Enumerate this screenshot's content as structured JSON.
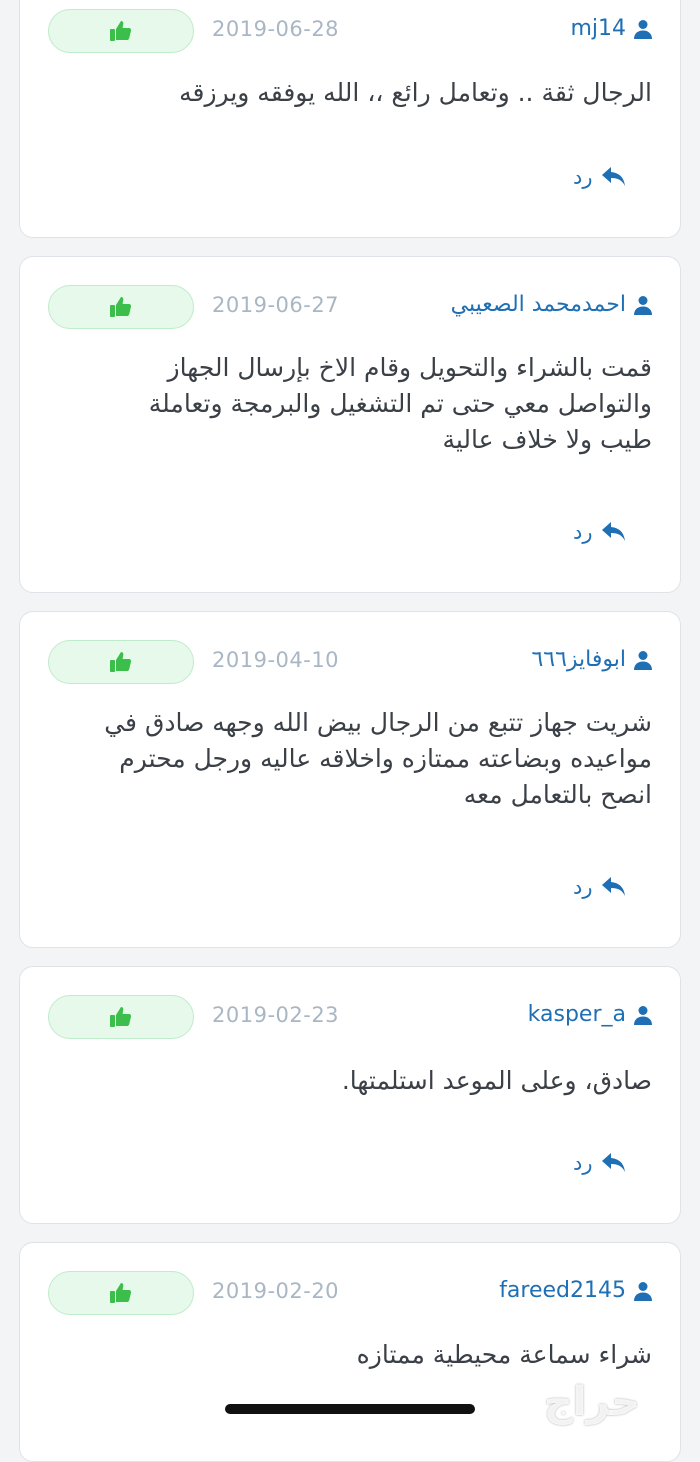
{
  "reviews": [
    {
      "user": "mj14",
      "date": "2019-06-28",
      "comment": "الرجال ثقة .. وتعامل رائع ،، الله يوفقه ويرزقه",
      "reply_label": "رد"
    },
    {
      "user": "احمدمحمد الصعيبي",
      "date": "2019-06-27",
      "comment": "قمت بالشراء والتحويل وقام الاخ بإرسال الجهاز والتواصل معي حتى تم التشغيل والبرمجة وتعاملة طيب ولا خلاف عالية",
      "reply_label": "رد"
    },
    {
      "user": "ابوفايز٦٦٦",
      "date": "2019-04-10",
      "comment": "شريت جهاز تتبع من الرجال بيض الله وجهه صادق في مواعيده وبضاعته ممتازه واخلاقه عاليه ورجل محترم انصح بالتعامل معه",
      "reply_label": "رد"
    },
    {
      "user": "kasper_a",
      "date": "2019-02-23",
      "comment": "صادق، وعلى الموعد استلمتها.",
      "reply_label": "رد"
    },
    {
      "user": "fareed2145",
      "date": "2019-02-20",
      "comment": "شراء سماعة محيطية ممتازه",
      "reply_label": "رد"
    }
  ],
  "watermark": "حراج",
  "icons": {
    "thumb": "thumbs-up-icon",
    "user": "user-icon",
    "reply": "reply-icon"
  },
  "colors": {
    "accent": "#1f6fb5",
    "thumb": "#3cbf4a",
    "badge_bg": "#e6f9ea"
  }
}
